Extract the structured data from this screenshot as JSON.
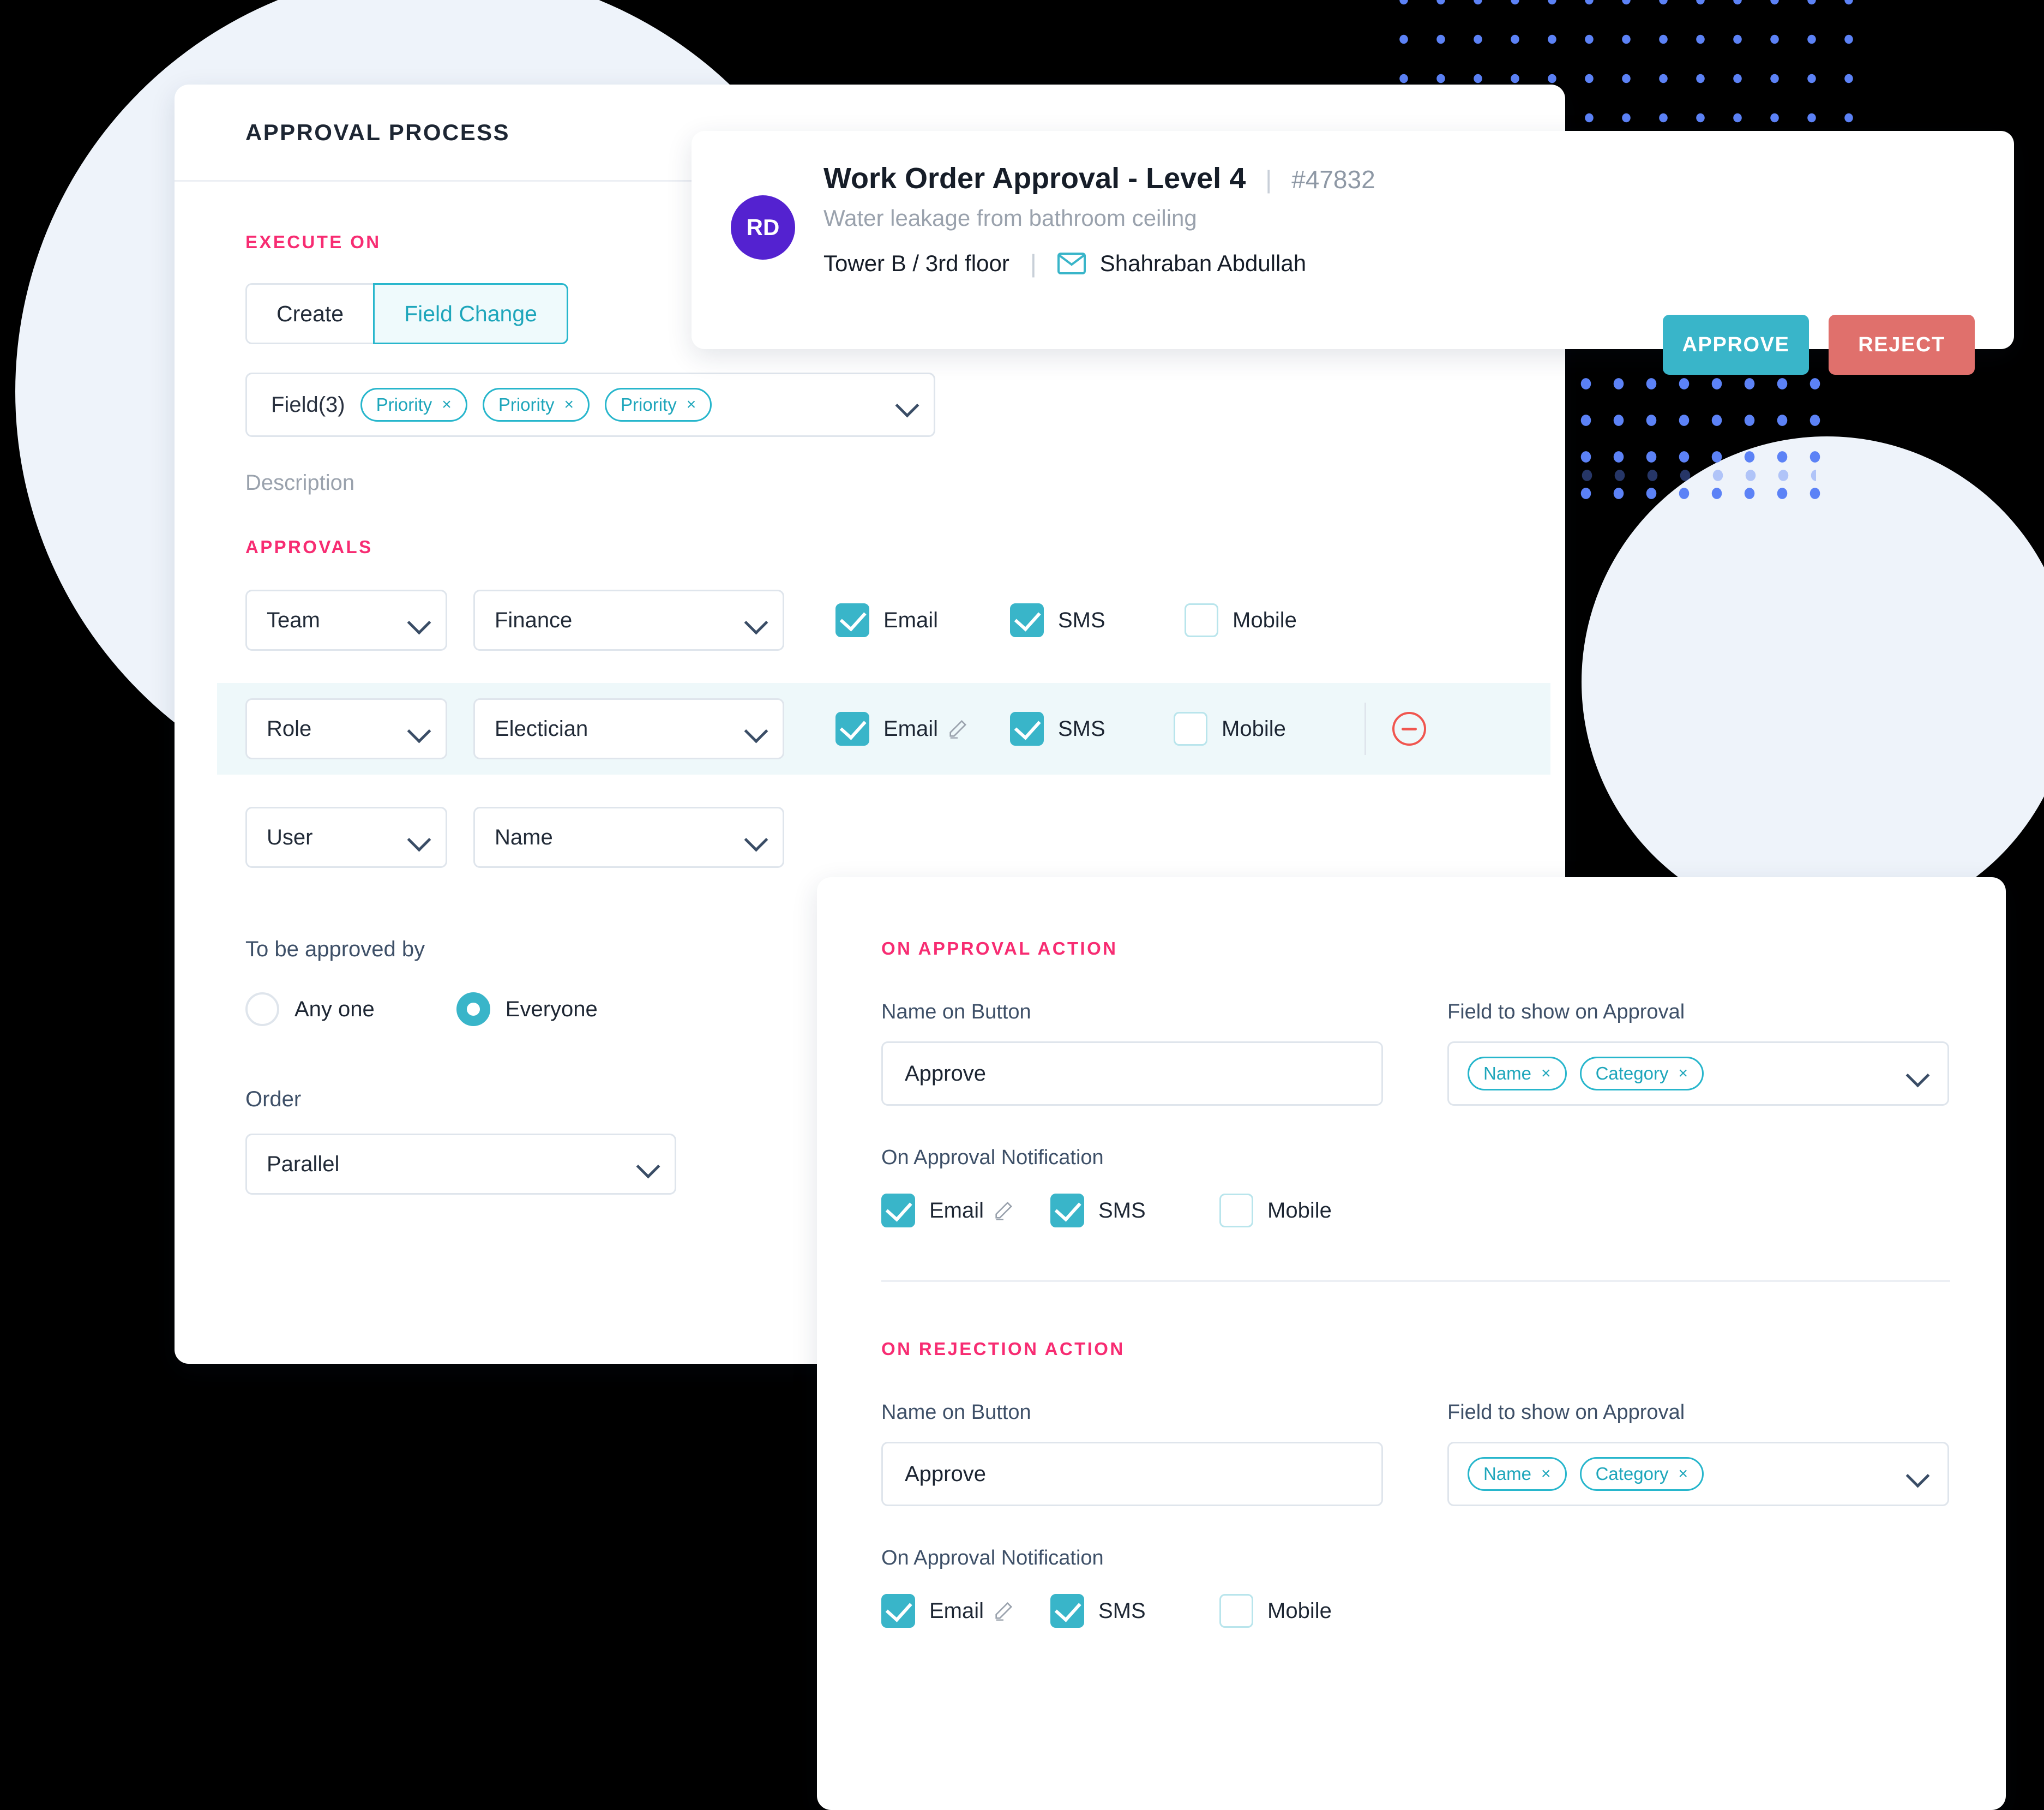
{
  "colors": {
    "accent_teal": "#39b5c9",
    "accent_pink": "#f72c72",
    "reject_red": "#e0706c",
    "avatar_purple": "#5422d0",
    "dot_blue": "#5c82f6",
    "panel_bg": "#ffffff",
    "page_bg": "#000000",
    "circle_bg": "#eef3fa",
    "row_highlight": "#eef8fa"
  },
  "approval_panel": {
    "title": "APPROVAL PROCESS",
    "execute_on": {
      "label": "EXECUTE ON",
      "tabs": [
        {
          "label": "Create",
          "active": false
        },
        {
          "label": "Field Change",
          "active": true
        }
      ],
      "field_select": {
        "label": "Field(3)",
        "chips": [
          "Priority",
          "Priority",
          "Priority"
        ],
        "chip_remove": "×",
        "caret_icon": "chevron-down-icon"
      },
      "description_placeholder": "Description"
    },
    "approvals": {
      "label": "APPROVALS",
      "rows": [
        {
          "type_value": "Team",
          "name_value": "Finance",
          "highlight": false,
          "has_pencil": false,
          "has_remove": false,
          "channels": [
            {
              "label": "Email",
              "checked": true
            },
            {
              "label": "SMS",
              "checked": true
            },
            {
              "label": "Mobile",
              "checked": false
            }
          ]
        },
        {
          "type_value": "Role",
          "name_value": "Electician",
          "highlight": true,
          "has_pencil": true,
          "has_remove": true,
          "channels": [
            {
              "label": "Email",
              "checked": true
            },
            {
              "label": "SMS",
              "checked": true
            },
            {
              "label": "Mobile",
              "checked": false
            }
          ]
        },
        {
          "type_value": "User",
          "name_value": "Name",
          "highlight": false,
          "has_pencil": false,
          "has_remove": false,
          "channels": []
        }
      ],
      "approved_by_label": "To be approved by",
      "radios": [
        {
          "label": "Any one",
          "selected": false
        },
        {
          "label": "Everyone",
          "selected": true
        }
      ],
      "order_label": "Order",
      "order_value": "Parallel"
    }
  },
  "work_order_card": {
    "avatar_initials": "RD",
    "title": "Work Order Approval - Level 4",
    "separator": "|",
    "id": "#47832",
    "subtitle": "Water leakage from bathroom ceiling",
    "location": "Tower B / 3rd floor",
    "mail_icon": "envelope-icon",
    "person": "Shahraban Abdullah",
    "approve_label": "APPROVE",
    "reject_label": "REJECT"
  },
  "action_panel": {
    "approval": {
      "section_label": "ON APPROVAL ACTION",
      "button_name_label": "Name on Button",
      "button_name_value": "Approve",
      "field_show_label": "Field to show on Approval",
      "field_chips": [
        "Name",
        "Category"
      ],
      "chip_remove": "×",
      "notification_label": "On Approval Notification",
      "channels": [
        {
          "label": "Email",
          "checked": true,
          "has_pencil": true
        },
        {
          "label": "SMS",
          "checked": true,
          "has_pencil": false
        },
        {
          "label": "Mobile",
          "checked": false,
          "has_pencil": false
        }
      ]
    },
    "rejection": {
      "section_label": "ON REJECTION ACTION",
      "button_name_label": "Name on Button",
      "button_name_value": "Approve",
      "field_show_label": "Field to show on Approval",
      "field_chips": [
        "Name",
        "Category"
      ],
      "chip_remove": "×",
      "notification_label": "On Approval Notification",
      "channels": [
        {
          "label": "Email",
          "checked": true,
          "has_pencil": true
        },
        {
          "label": "SMS",
          "checked": true,
          "has_pencil": false
        },
        {
          "label": "Mobile",
          "checked": false,
          "has_pencil": false
        }
      ]
    }
  }
}
